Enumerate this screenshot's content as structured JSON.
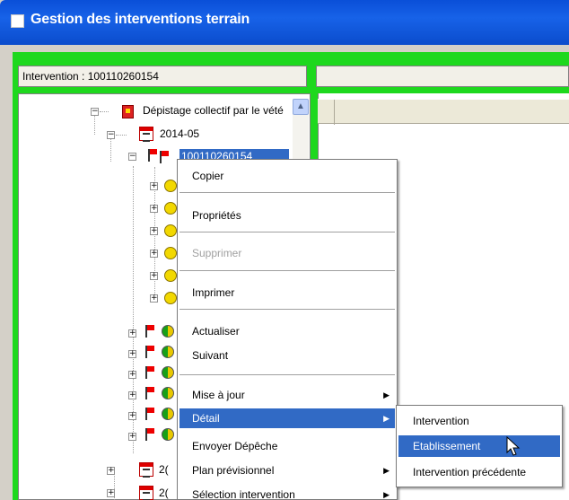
{
  "window": {
    "title": "Gestion des interventions terrain"
  },
  "intervention_label": "Intervention : 100110260154",
  "tree": {
    "root_label": "Dépistage collectif par le vété",
    "period_label": "2014-05",
    "selected_node": "100110260154",
    "truncated_labels": [
      "2(",
      "2("
    ]
  },
  "context_menu": {
    "items": [
      {
        "label": "Copier",
        "enabled": true,
        "has_submenu": false
      },
      {
        "label": "Propriétés",
        "enabled": true,
        "has_submenu": false
      },
      {
        "label": "Supprimer",
        "enabled": false,
        "has_submenu": false
      },
      {
        "label": "Imprimer",
        "enabled": true,
        "has_submenu": false
      },
      {
        "label": "Actualiser",
        "enabled": true,
        "has_submenu": false
      },
      {
        "label": "Suivant",
        "enabled": true,
        "has_submenu": false
      },
      {
        "label": "Mise à jour",
        "enabled": true,
        "has_submenu": true
      },
      {
        "label": "Détail",
        "enabled": true,
        "has_submenu": true,
        "highlighted": true
      },
      {
        "label": "Envoyer Dépêche",
        "enabled": true,
        "has_submenu": false
      },
      {
        "label": "Plan prévisionnel",
        "enabled": true,
        "has_submenu": true
      },
      {
        "label": "Sélection intervention",
        "enabled": true,
        "has_submenu": true
      }
    ]
  },
  "submenu": {
    "items": [
      {
        "label": "Intervention"
      },
      {
        "label": "Etablissement",
        "highlighted": true
      },
      {
        "label": "Intervention précédente"
      }
    ]
  },
  "colors": {
    "titlebar": "#0b4ccc",
    "frame_border": "#1ed81e",
    "selection": "#316ac5"
  }
}
